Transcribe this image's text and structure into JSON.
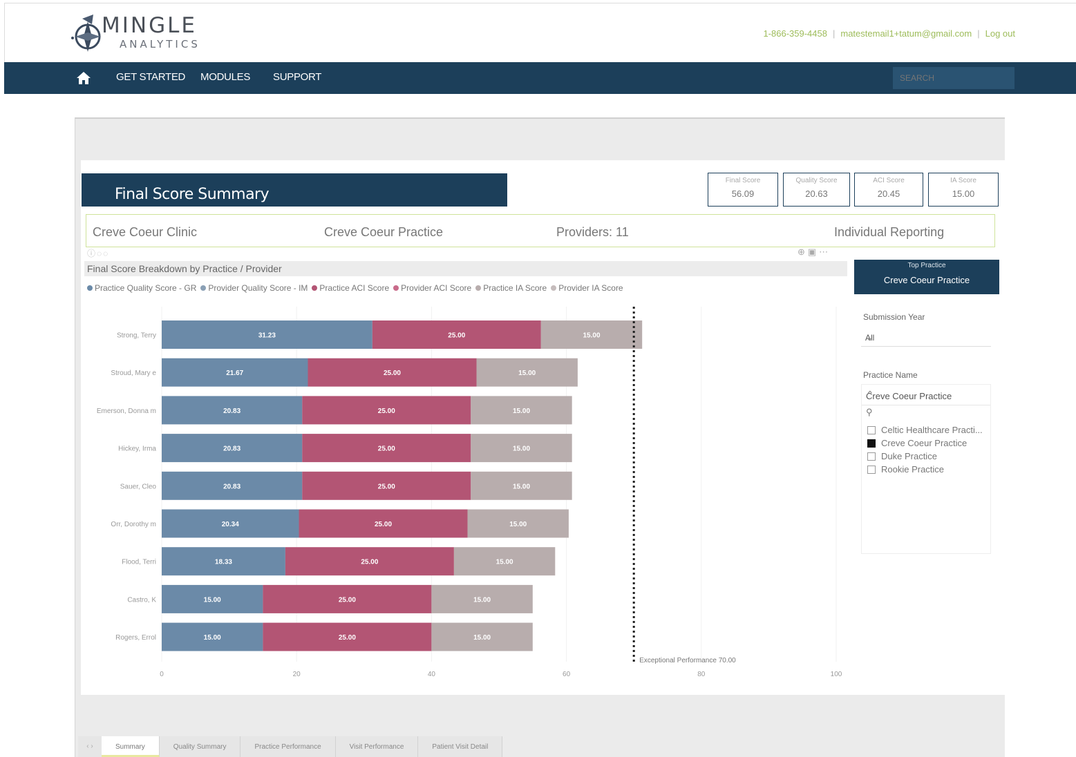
{
  "brand": {
    "name": "MINGLE",
    "sub": "ANALYTICS"
  },
  "top_links": {
    "phone": "1-866-359-4458",
    "email": "matestemail1+tatum@gmail.com",
    "logout": "Log out"
  },
  "nav": {
    "items": [
      "GET STARTED",
      "MODULES",
      "SUPPORT"
    ],
    "search_placeholder": "SEARCH"
  },
  "report": {
    "title": "Final Score Summary",
    "kpis": [
      {
        "label": "Final Score",
        "value": "56.09"
      },
      {
        "label": "Quality Score",
        "value": "20.63"
      },
      {
        "label": "ACI Score",
        "value": "20.45"
      },
      {
        "label": "IA Score",
        "value": "15.00"
      }
    ],
    "info": {
      "clinic": "Creve Coeur Clinic",
      "practice": "Creve Coeur Practice",
      "providers": "Providers: 11",
      "reporting": "Individual Reporting"
    },
    "chart_title": "Final Score Breakdown by Practice / Provider",
    "top_practice": {
      "label": "Top Practice",
      "value": "Creve Coeur Practice"
    },
    "submission_year": {
      "label": "Submission Year",
      "value": "All"
    },
    "practice_name": {
      "label": "Practice Name",
      "selected": "Creve Coeur Practice",
      "options": [
        {
          "name": "Celtic Healthcare Practi...",
          "checked": false
        },
        {
          "name": "Creve Coeur Practice",
          "checked": true
        },
        {
          "name": "Duke Practice",
          "checked": false
        },
        {
          "name": "Rookie Practice",
          "checked": false
        }
      ]
    },
    "tabs": [
      "Summary",
      "Quality Summary",
      "Practice Performance",
      "Visit Performance",
      "Patient Visit Detail"
    ]
  },
  "chart_data": {
    "type": "bar",
    "orientation": "horizontal",
    "stacked": true,
    "categories": [
      "Strong, Terry",
      "Stroud, Mary e",
      "Emerson, Donna m",
      "Hickey, Irma",
      "Sauer, Cleo",
      "Orr, Dorothy m",
      "Flood, Terri",
      "Castro, K",
      "Rogers, Errol"
    ],
    "series": [
      {
        "name": "Practice Quality Score - GR",
        "color": "#6b8aa8",
        "values": [
          31.23,
          21.67,
          20.83,
          20.83,
          20.83,
          20.34,
          18.33,
          15.0,
          15.0
        ]
      },
      {
        "name": "Provider Quality Score - IM",
        "color": "#8aa0b5",
        "values": [
          0,
          0,
          0,
          0,
          0,
          0,
          0,
          0,
          0
        ]
      },
      {
        "name": "Practice ACI Score",
        "color": "#b35574",
        "values": [
          25.0,
          25.0,
          25.0,
          25.0,
          25.0,
          25.0,
          25.0,
          25.0,
          25.0
        ]
      },
      {
        "name": "Provider ACI Score",
        "color": "#c96b8a",
        "values": [
          0,
          0,
          0,
          0,
          0,
          0,
          0,
          0,
          0
        ]
      },
      {
        "name": "Practice IA Score",
        "color": "#b8adad",
        "values": [
          15.0,
          15.0,
          15.0,
          15.0,
          15.0,
          15.0,
          15.0,
          15.0,
          15.0
        ]
      },
      {
        "name": "Provider IA Score",
        "color": "#c5bcbc",
        "values": [
          0,
          0,
          0,
          0,
          0,
          0,
          0,
          0,
          0
        ]
      }
    ],
    "labels": [
      [
        "31.23",
        "25.00",
        "15.00"
      ],
      [
        "21.67",
        "25.00",
        "15.00"
      ],
      [
        "20.83",
        "25.00",
        "15.00"
      ],
      [
        "20.83",
        "25.00",
        "15.00"
      ],
      [
        "20.83",
        "25.00",
        "15.00"
      ],
      [
        "20.34",
        "25.00",
        "15.00"
      ],
      [
        "18.33",
        "25.00",
        "15.00"
      ],
      [
        "15.00",
        "25.00",
        "15.00"
      ],
      [
        "15.00",
        "25.00",
        "15.00"
      ]
    ],
    "xlim": [
      0,
      100
    ],
    "xticks": [
      0,
      20,
      40,
      60,
      80,
      100
    ],
    "reference_line": {
      "value": 70,
      "label": "Exceptional Performance 70.00"
    },
    "legend_position": "top"
  }
}
